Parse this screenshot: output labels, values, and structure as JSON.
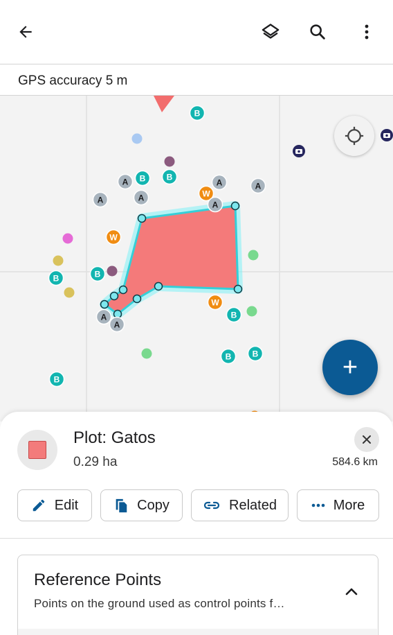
{
  "appbar": {
    "back_icon": "arrow-left-icon",
    "layers_icon": "layers-icon",
    "search_icon": "search-icon",
    "more_icon": "more-vertical-icon"
  },
  "gps": {
    "text": "GPS accuracy 5 m"
  },
  "map": {
    "plot_fill_color": "#f47a7a",
    "plot_outline_color": "#4fe0ea",
    "marker_colors": {
      "B": "#12b5b0",
      "A": "#a7b3bd",
      "W": "#f08c12"
    },
    "markers": [
      {
        "label": "B"
      },
      {
        "label": "A"
      },
      {
        "label": "B"
      },
      {
        "label": "B"
      },
      {
        "label": "A"
      },
      {
        "label": "A"
      },
      {
        "label": "A"
      },
      {
        "label": "W"
      },
      {
        "label": "A"
      },
      {
        "label": "A"
      },
      {
        "label": "W"
      },
      {
        "label": "B"
      },
      {
        "label": "B"
      },
      {
        "label": "W"
      },
      {
        "label": "B"
      },
      {
        "label": "A"
      },
      {
        "label": "A"
      },
      {
        "label": "B"
      },
      {
        "label": "B"
      },
      {
        "label": "B"
      }
    ]
  },
  "locate_icon": "crosshair-icon",
  "fab": {
    "label": "+",
    "icon": "add-icon"
  },
  "plot": {
    "title": "Plot: Gatos",
    "area": "0.29 ha",
    "distance": "584.6 km",
    "swatch_color": "#f37b7b"
  },
  "actions": [
    {
      "label": "Edit",
      "icon": "pencil-icon"
    },
    {
      "label": "Copy",
      "icon": "copy-icon"
    },
    {
      "label": "Related",
      "icon": "link-icon"
    },
    {
      "label": "More",
      "icon": "more-horizontal-icon"
    }
  ],
  "reference_points": {
    "title": "Reference Points",
    "subtitle": "Points on the ground used as control points f…",
    "chevron_icon": "chevron-up-icon"
  }
}
